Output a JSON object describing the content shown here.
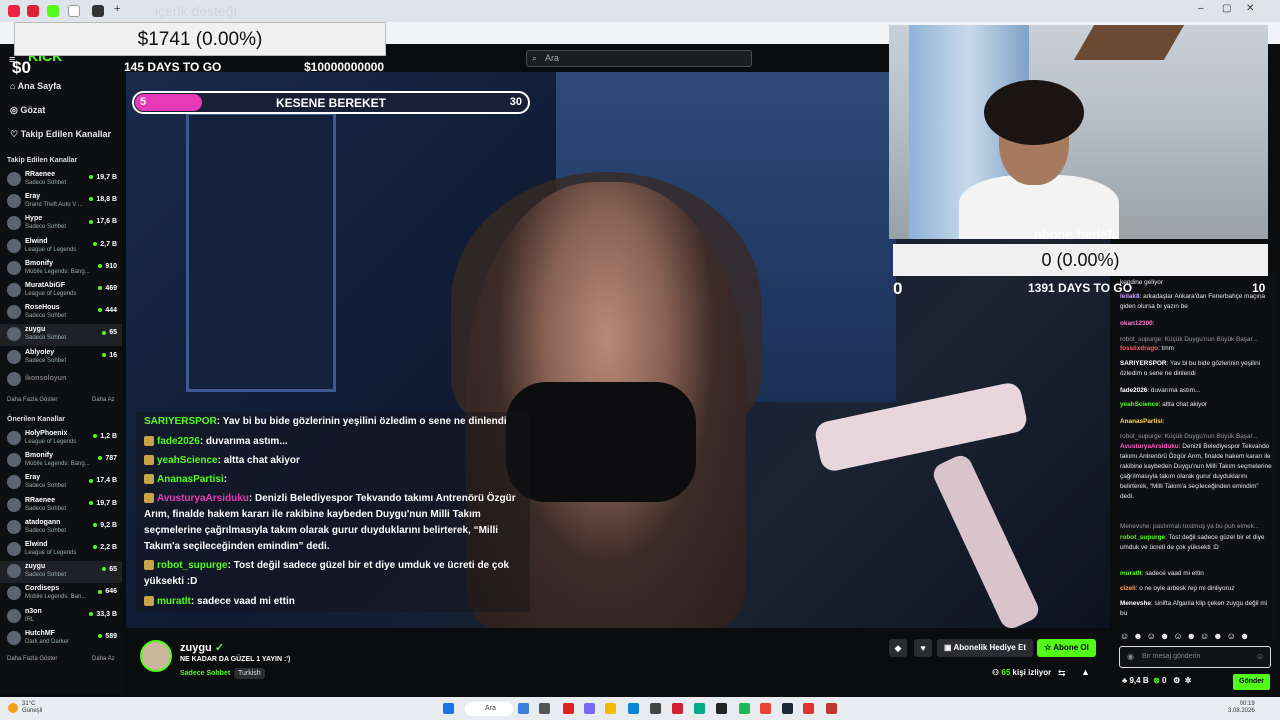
{
  "browser": {
    "tab_title": "içerik desteği"
  },
  "overlay_top": {
    "money": "$1741 (0.00%)",
    "zero": "$0",
    "days": "145 DAYS TO GO",
    "target": "$10000000000"
  },
  "search": {
    "placeholder": "Ara"
  },
  "logo": "KICK",
  "sidebar": {
    "nav": [
      "Ana Sayfa",
      "Gözat",
      "Takip Edilen Kanallar"
    ],
    "followed_header": "Takip Edilen Kanallar",
    "followed": [
      {
        "name": "RRaenee",
        "game": "Sadece Sohbet",
        "viewers": "19,7 B"
      },
      {
        "name": "Eray",
        "game": "Grand Theft Auto V ...",
        "viewers": "18,8 B"
      },
      {
        "name": "Hype",
        "game": "Sadece Sohbet",
        "viewers": "17,6 B"
      },
      {
        "name": "Elwind",
        "game": "League of Legends",
        "viewers": "2,7 B"
      },
      {
        "name": "Bmonify",
        "game": "Mobile Legends: Bang...",
        "viewers": "910"
      },
      {
        "name": "MuratAbiGF",
        "game": "League of Legends",
        "viewers": "469"
      },
      {
        "name": "RoseHous",
        "game": "Sadece Sohbet",
        "viewers": "444"
      },
      {
        "name": "zuygu",
        "game": "Sadece Sohbet",
        "viewers": "65"
      },
      {
        "name": "Ablyoley",
        "game": "Sadece Sohbet",
        "viewers": "16"
      },
      {
        "name": "ikonsoloyun",
        "game": "",
        "viewers": ""
      }
    ],
    "show_more": "Daha Fazla Göster",
    "show_less": "Daha Az",
    "suggested_header": "Önerilen Kanallar",
    "suggested": [
      {
        "name": "HolyPhoenix",
        "game": "League of Legends",
        "viewers": "1,2 B"
      },
      {
        "name": "Bmonify",
        "game": "Mobile Legends: Bang...",
        "viewers": "787"
      },
      {
        "name": "Eray",
        "game": "Sadece Sohbet",
        "viewers": "17,4 B"
      },
      {
        "name": "RRaenee",
        "game": "Sadece Sohbet",
        "viewers": "19,7 B"
      },
      {
        "name": "atadogann",
        "game": "Sadece Sohbet",
        "viewers": "9,2 B"
      },
      {
        "name": "Elwind",
        "game": "League of Legends",
        "viewers": "2,2 B"
      },
      {
        "name": "zuygu",
        "game": "Sadece Sohbet",
        "viewers": "65"
      },
      {
        "name": "Cordiseps",
        "game": "Mobile Legends: Ban...",
        "viewers": "646"
      },
      {
        "name": "n3on",
        "game": "IRL",
        "viewers": "33,3 B"
      },
      {
        "name": "HutchMF",
        "game": "Dark and Darker",
        "viewers": "589"
      }
    ],
    "show_more2": "Daha Fazla Göster",
    "show_less2": "Daha Az"
  },
  "goal": {
    "left": "5",
    "title": "KESENE BEREKET",
    "right": "30",
    "fill_fraction": 0.17
  },
  "overlay_chat": [
    {
      "user": "SARIYERSPOR",
      "text": ": Yav bi bu bide gözlerinin yeşilini özledim o sene ne dinlendi"
    },
    {
      "user": "fade2026",
      "text": ": duvarıma astım..."
    },
    {
      "user": "yeahScience",
      "text": ": altta chat akiyor"
    },
    {
      "user": "AnanasPartisi",
      "text": ":"
    },
    {
      "user": "AvusturyaArsiduku",
      "text": ": Denizli Belediyespor Tekvando takımı Antrenörü Özgür Arım, finalde hakem kararı ile rakibine kaybeden Duygu'nun Milli Takım seçmelerine çağrılmasıyla takım olarak gurur duyduklarını belirterek, “Milli Takım'a seçileceğinden emindim” dedi."
    },
    {
      "user": "robot_supurge",
      "text": ": Tost değil sadece güzel bir et diye umduk ve ücreti de çok yüksekti :D"
    },
    {
      "user": "muratlt",
      "text": ": sadece vaad mi ettin"
    }
  ],
  "sub_goal": {
    "label": "abone hedefi",
    "value": "0 (0.00%)",
    "zero": "0",
    "days": "1391 DAYS TO GO",
    "target": "10"
  },
  "chat": [
    {
      "user": "",
      "text": "kendine geliyor",
      "sys": false
    },
    {
      "user": "leilak8",
      "text": ": arkadaşlar Ankara'dan Fenerbahçe maçına giden olursa bı yazın be",
      "sys": false
    },
    {
      "user": "okan12300",
      "text": ":",
      "sys": false
    },
    {
      "user": "",
      "text": "robot_supurge: Küçük Duygu'nun Büyük Başar...",
      "sys": true
    },
    {
      "user": "fossiixdrago",
      "text": ": tmm",
      "sys": false
    },
    {
      "user": "SARIYERSPOR",
      "text": ": Yav bi bu bide gözlerinin yeşilini özledim o sene ne dinlendi",
      "sys": false
    },
    {
      "user": "fade2026",
      "text": ": duvarıma astım...",
      "sys": false
    },
    {
      "user": "yeahScience",
      "text": ": altta chat akiyor",
      "sys": false
    },
    {
      "user": "AnanasPartisi",
      "text": ":",
      "sys": false
    },
    {
      "user": "",
      "text": "robot_supurge: Küçük Duygu'nun Büyük Başar...",
      "sys": true
    },
    {
      "user": "AvusturyaArsiduku",
      "text": ": Denizli Belediyespor Tekvando takımı Antrenörü Özgür Arım, finalde hakem kararı ile rakibine kaybeden Duygu'nun Milli Takım seçmelerine çağrılmasıyla takım olarak gurur duyduklarını belirterek, “Milli Takım'a seçileceğinden emindim” dedi.",
      "sys": false
    },
    {
      "user": "",
      "text": "Menevshe: pastırmalı tostmuş ya bu puh elmek...",
      "sys": true
    },
    {
      "user": "robot_supurge",
      "text": ": Tost değil sadece güzel bir et diye umduk ve ücreti de çok yüksekti :D",
      "sys": false
    },
    {
      "user": "muratlt",
      "text": ": sadece vaad mi ettin",
      "sys": false
    },
    {
      "user": "cizeli",
      "text": ": o ne oyle arbesk rep mi dinliyoruz",
      "sys": false
    },
    {
      "user": "Menevshe",
      "text": ": sinifta Afganla klip çeken zuygu değil mi bu",
      "sys": false
    }
  ],
  "chat_input": {
    "placeholder": "Bir mesaj gönderin",
    "send": "Gönder",
    "points": "9,4 B",
    "count": "0"
  },
  "streamer": {
    "name": "zuygu",
    "title": "NE KADAR DA GÜZEL 1 YAYIN :')",
    "category": "Sadece Sohbet",
    "language": "Turkish",
    "subgift": "Abonelik Hediye Et",
    "subscribe": "Abone Ol",
    "viewers_count": "65",
    "viewers_label": "kişi izliyor"
  },
  "taskbar": {
    "search": "Ara",
    "weather_temp": "31°C",
    "weather_desc": "Güneşli",
    "time": "00:19",
    "date": "3.08.2026"
  },
  "colors": {
    "accent": "#53fc18",
    "goal_fill": "#e83ab8"
  }
}
